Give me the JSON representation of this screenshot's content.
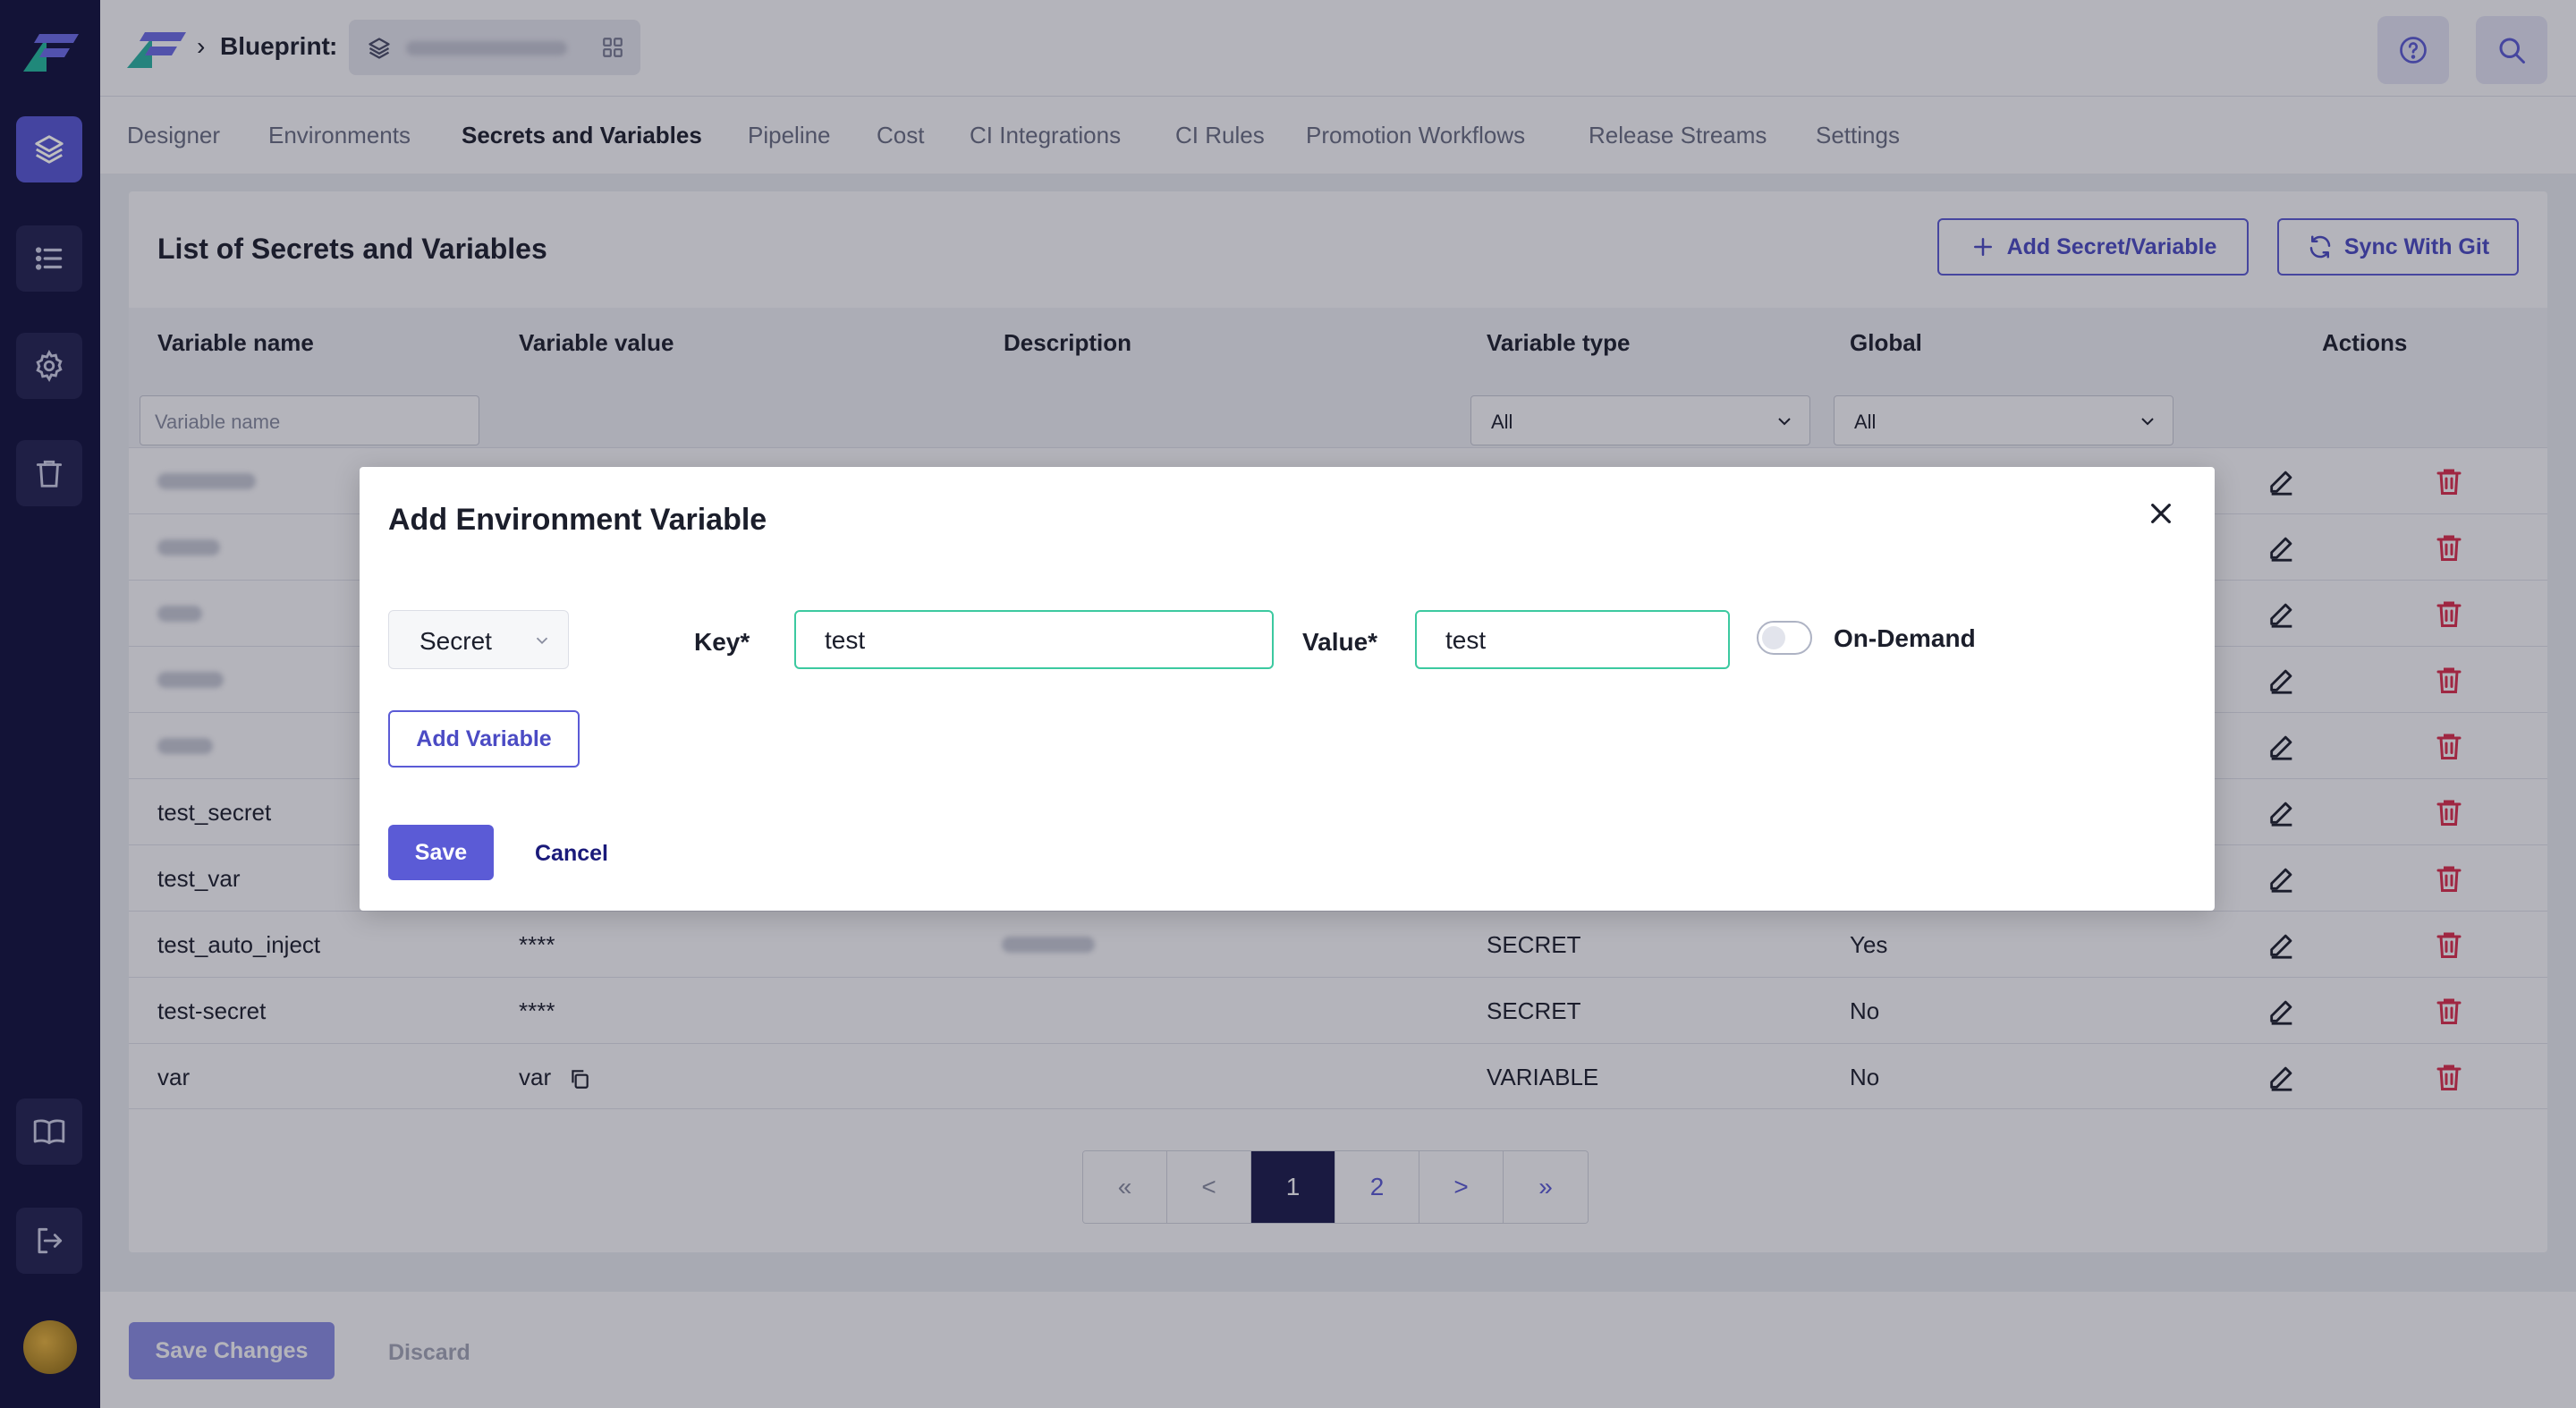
{
  "breadcrumb": {
    "title": "Blueprint",
    "separator": ":"
  },
  "tabs": [
    {
      "label": "Designer"
    },
    {
      "label": "Environments"
    },
    {
      "label": "Secrets and Variables"
    },
    {
      "label": "Pipeline"
    },
    {
      "label": "Cost"
    },
    {
      "label": "CI Integrations"
    },
    {
      "label": "CI Rules"
    },
    {
      "label": "Promotion Workflows"
    },
    {
      "label": "Release Streams"
    },
    {
      "label": "Settings"
    }
  ],
  "active_tab": "Secrets and Variables",
  "card": {
    "title": "List of Secrets and Variables",
    "add_button": "Add Secret/Variable",
    "sync_button": "Sync With Git"
  },
  "table": {
    "headers": {
      "name": "Variable name",
      "value": "Variable value",
      "description": "Description",
      "type": "Variable type",
      "global": "Global",
      "actions": "Actions"
    },
    "filters": {
      "name_placeholder": "Variable name",
      "type_selected": "All",
      "global_selected": "All"
    },
    "rows": [
      {
        "name": "test_secret",
        "value": "",
        "type": "",
        "global": ""
      },
      {
        "name": "test_var",
        "value": "",
        "type": "",
        "global": ""
      },
      {
        "name": "test_auto_inject",
        "value": "****",
        "type": "SECRET",
        "global": "Yes"
      },
      {
        "name": "test-secret",
        "value": "****",
        "type": "SECRET",
        "global": "No"
      },
      {
        "name": "var",
        "value": "var",
        "type": "VARIABLE",
        "global": "No"
      }
    ]
  },
  "pagination": {
    "first": "«",
    "prev": "<",
    "pages": [
      "1",
      "2"
    ],
    "current": "1",
    "next": ">",
    "last": "»"
  },
  "bottombar": {
    "save_changes": "Save Changes",
    "discard": "Discard"
  },
  "modal": {
    "title": "Add Environment Variable",
    "type_value": "Secret",
    "key_label": "Key*",
    "key_value": "test",
    "value_label": "Value*",
    "value_value": "test",
    "toggle_label": "On-Demand",
    "toggle_on": false,
    "add_variable": "Add Variable",
    "save": "Save",
    "cancel": "Cancel"
  },
  "colors": {
    "sidebar": "#1a1a4a",
    "accent": "#5b5bd6",
    "field_border": "#3cc9a0",
    "danger": "#e02d4b"
  }
}
